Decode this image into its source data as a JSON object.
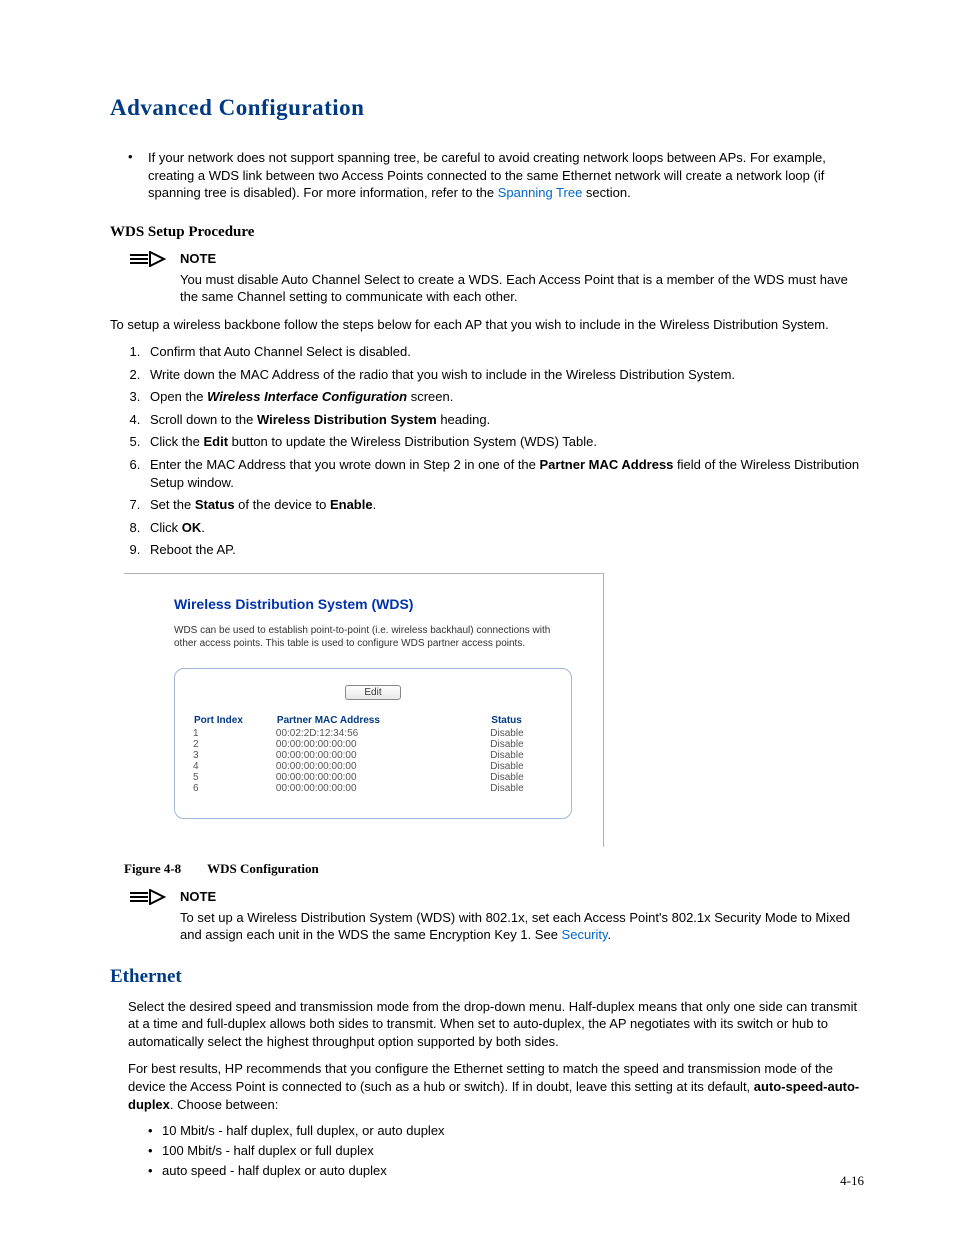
{
  "title": "Advanced Configuration",
  "bullet1_pre": "If your network does not support spanning tree, be careful to avoid creating network loops between APs. For example, creating a WDS link between two Access Points connected to the same Ethernet network will create a network loop (if spanning tree is disabled). For more information, refer to the ",
  "bullet1_link": "Spanning Tree",
  "bullet1_post": " section.",
  "wds_heading": "WDS Setup Procedure",
  "note_label": "NOTE",
  "note1_text": "You must disable Auto Channel Select to create a WDS. Each Access Point that is a member of the WDS must have the same Channel setting to communicate with each other.",
  "setup_intro": "To setup a wireless backbone follow the steps below for each AP that you wish to include in the Wireless Distribution System.",
  "steps": {
    "s1": "Confirm that Auto Channel Select is disabled.",
    "s2": "Write down the MAC Address of the radio that you wish to include in the Wireless Distribution System.",
    "s3_pre": "Open the ",
    "s3_b": "Wireless Interface Configuration",
    "s3_post": " screen.",
    "s4_pre": "Scroll down to the ",
    "s4_b": "Wireless Distribution System",
    "s4_post": " heading.",
    "s5_pre": "Click the ",
    "s5_b": "Edit",
    "s5_post": " button to update the Wireless Distribution System (WDS) Table.",
    "s6_pre": "Enter the MAC Address that you wrote down in Step 2 in one of the ",
    "s6_b": "Partner MAC Address",
    "s6_post": " field of the Wireless Distribution Setup window.",
    "s7_pre": "Set the ",
    "s7_b1": "Status",
    "s7_mid": " of the device to ",
    "s7_b2": "Enable",
    "s7_post": ".",
    "s8_pre": "Click ",
    "s8_b": "OK",
    "s8_post": ".",
    "s9": "Reboot the AP."
  },
  "figure": {
    "title": "Wireless Distribution System (WDS)",
    "desc": "WDS can be used to establish point-to-point (i.e. wireless backhaul) connections with other access points. This table is used to configure WDS partner access points.",
    "edit_label": "Edit",
    "headers": {
      "port": "Port Index",
      "mac": "Partner MAC Address",
      "status": "Status"
    },
    "rows": [
      {
        "port": "1",
        "mac": "00:02:2D:12:34:56",
        "status": "Disable"
      },
      {
        "port": "2",
        "mac": "00:00:00:00:00:00",
        "status": "Disable"
      },
      {
        "port": "3",
        "mac": "00:00:00:00:00:00",
        "status": "Disable"
      },
      {
        "port": "4",
        "mac": "00:00:00:00:00:00",
        "status": "Disable"
      },
      {
        "port": "5",
        "mac": "00:00:00:00:00:00",
        "status": "Disable"
      },
      {
        "port": "6",
        "mac": "00:00:00:00:00:00",
        "status": "Disable"
      }
    ]
  },
  "fig_caption_num": "Figure 4-8",
  "fig_caption_title": "WDS Configuration",
  "note2_pre": "To set up a Wireless Distribution System (WDS) with 802.1x, set each Access Point's 802.1x Security Mode to Mixed and assign each unit in the WDS the same Encryption Key 1. See ",
  "note2_link": "Security",
  "note2_post": ".",
  "ethernet_heading": "Ethernet",
  "eth_p1": "Select the desired speed and transmission mode from the drop-down menu. Half-duplex means that only one side can transmit at a time and full-duplex allows both sides to transmit. When set to auto-duplex, the AP negotiates with its switch or hub to automatically select the highest throughput option supported by both sides.",
  "eth_p2_pre": "For best results, HP recommends that you configure the Ethernet setting to match the speed and transmission mode of the device the Access Point is connected to (such as a hub or switch). If in doubt, leave this setting at its default, ",
  "eth_p2_b": "auto-speed-auto-duplex",
  "eth_p2_post": ". Choose between:",
  "eth_opts": {
    "o1": "10 Mbit/s - half duplex, full duplex, or auto duplex",
    "o2": "100 Mbit/s - half duplex or full duplex",
    "o3": "auto speed - half duplex or auto duplex"
  },
  "page_number": "4-16"
}
